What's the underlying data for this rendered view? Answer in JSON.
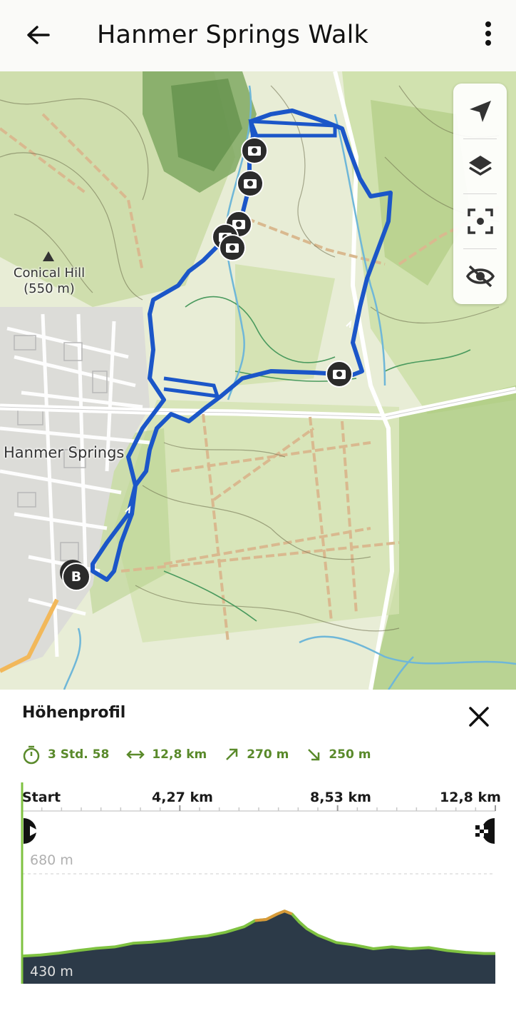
{
  "header": {
    "title": "Hanmer Springs Walk",
    "back_icon": "arrow-left-icon",
    "menu_icon": "more-vertical-icon"
  },
  "map": {
    "labels": {
      "peak_name": "Conical Hill",
      "peak_elevation": "(550 m)",
      "town": "Hanmer Springs"
    },
    "start_marker": "B",
    "route_color": "#1b56c8",
    "photo_marker_count": 6
  },
  "map_tools": [
    {
      "name": "locate-icon"
    },
    {
      "name": "layers-icon"
    },
    {
      "name": "focus-route-icon"
    },
    {
      "name": "visibility-off-icon"
    }
  ],
  "profile": {
    "title": "Höhenprofil",
    "close_icon": "close-icon",
    "stats": {
      "duration": "3 Std. 58",
      "distance": "12,8 km",
      "ascent": "270 m",
      "descent": "250 m"
    },
    "accent": "#5a8a2b"
  },
  "chart_data": {
    "type": "area",
    "x_ticks": [
      "Start",
      "4,27 km",
      "8,53 km",
      "12,8 km"
    ],
    "xlim": [
      0,
      12.8
    ],
    "ylim": [
      430,
      680
    ],
    "y_ticks": [
      "680 m",
      "430 m"
    ],
    "x": [
      0,
      0.5,
      1.0,
      1.5,
      2.0,
      2.5,
      3.0,
      3.5,
      4.0,
      4.5,
      5.0,
      5.5,
      6.0,
      6.3,
      6.6,
      6.9,
      7.1,
      7.3,
      7.5,
      7.7,
      8.0,
      8.5,
      9.0,
      9.5,
      10.0,
      10.5,
      11.0,
      11.5,
      12.0,
      12.5,
      12.8
    ],
    "y": [
      455,
      458,
      463,
      470,
      476,
      480,
      490,
      493,
      498,
      505,
      510,
      520,
      535,
      552,
      555,
      570,
      578,
      570,
      548,
      530,
      512,
      492,
      485,
      475,
      480,
      475,
      478,
      470,
      465,
      462,
      462
    ],
    "area_color": "#2c3a48",
    "line_color": "#7fc241",
    "peak_color": "#d89a3a"
  }
}
